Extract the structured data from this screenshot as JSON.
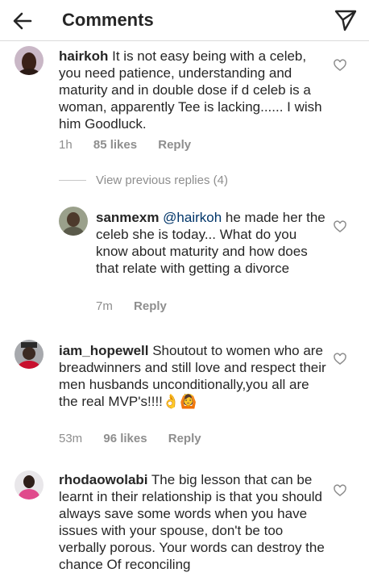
{
  "header": {
    "title": "Comments",
    "back_icon": "arrow-left-icon",
    "send_icon": "paper-plane-icon"
  },
  "comments": [
    {
      "username": "hairkoh",
      "text": "It is not easy being with a celeb, you need patience, understanding and maturity and in double dose if d celeb is a woman, apparently Tee is lacking...... I wish him Goodluck.",
      "time": "1h",
      "likes": "85 likes",
      "reply": "Reply"
    },
    {
      "username": "sanmexm",
      "mention": "@hairkoh",
      "text": "he made her the celeb she is today... What do you know about maturity and how does that relate with getting a divorce",
      "time": "7m",
      "reply": "Reply"
    },
    {
      "username": "iam_hopewell",
      "text": "Shoutout to women who are breadwinners and still love and respect their men husbands unconditionally,you all are the real MVP's!!!!",
      "emojis": "👌🙆",
      "time": "53m",
      "likes": "96 likes",
      "reply": "Reply"
    },
    {
      "username": "rhodaowolabi",
      "text": "The big lesson that can be learnt in their relationship is that you should always save some words when you have issues with your spouse,  don't be too verbally porous. Your words can destroy the chance Of reconciling"
    }
  ],
  "view_replies": "View previous replies (4)",
  "colors": {
    "text": "#262626",
    "meta": "#8e8e8e",
    "mention": "#003569"
  }
}
